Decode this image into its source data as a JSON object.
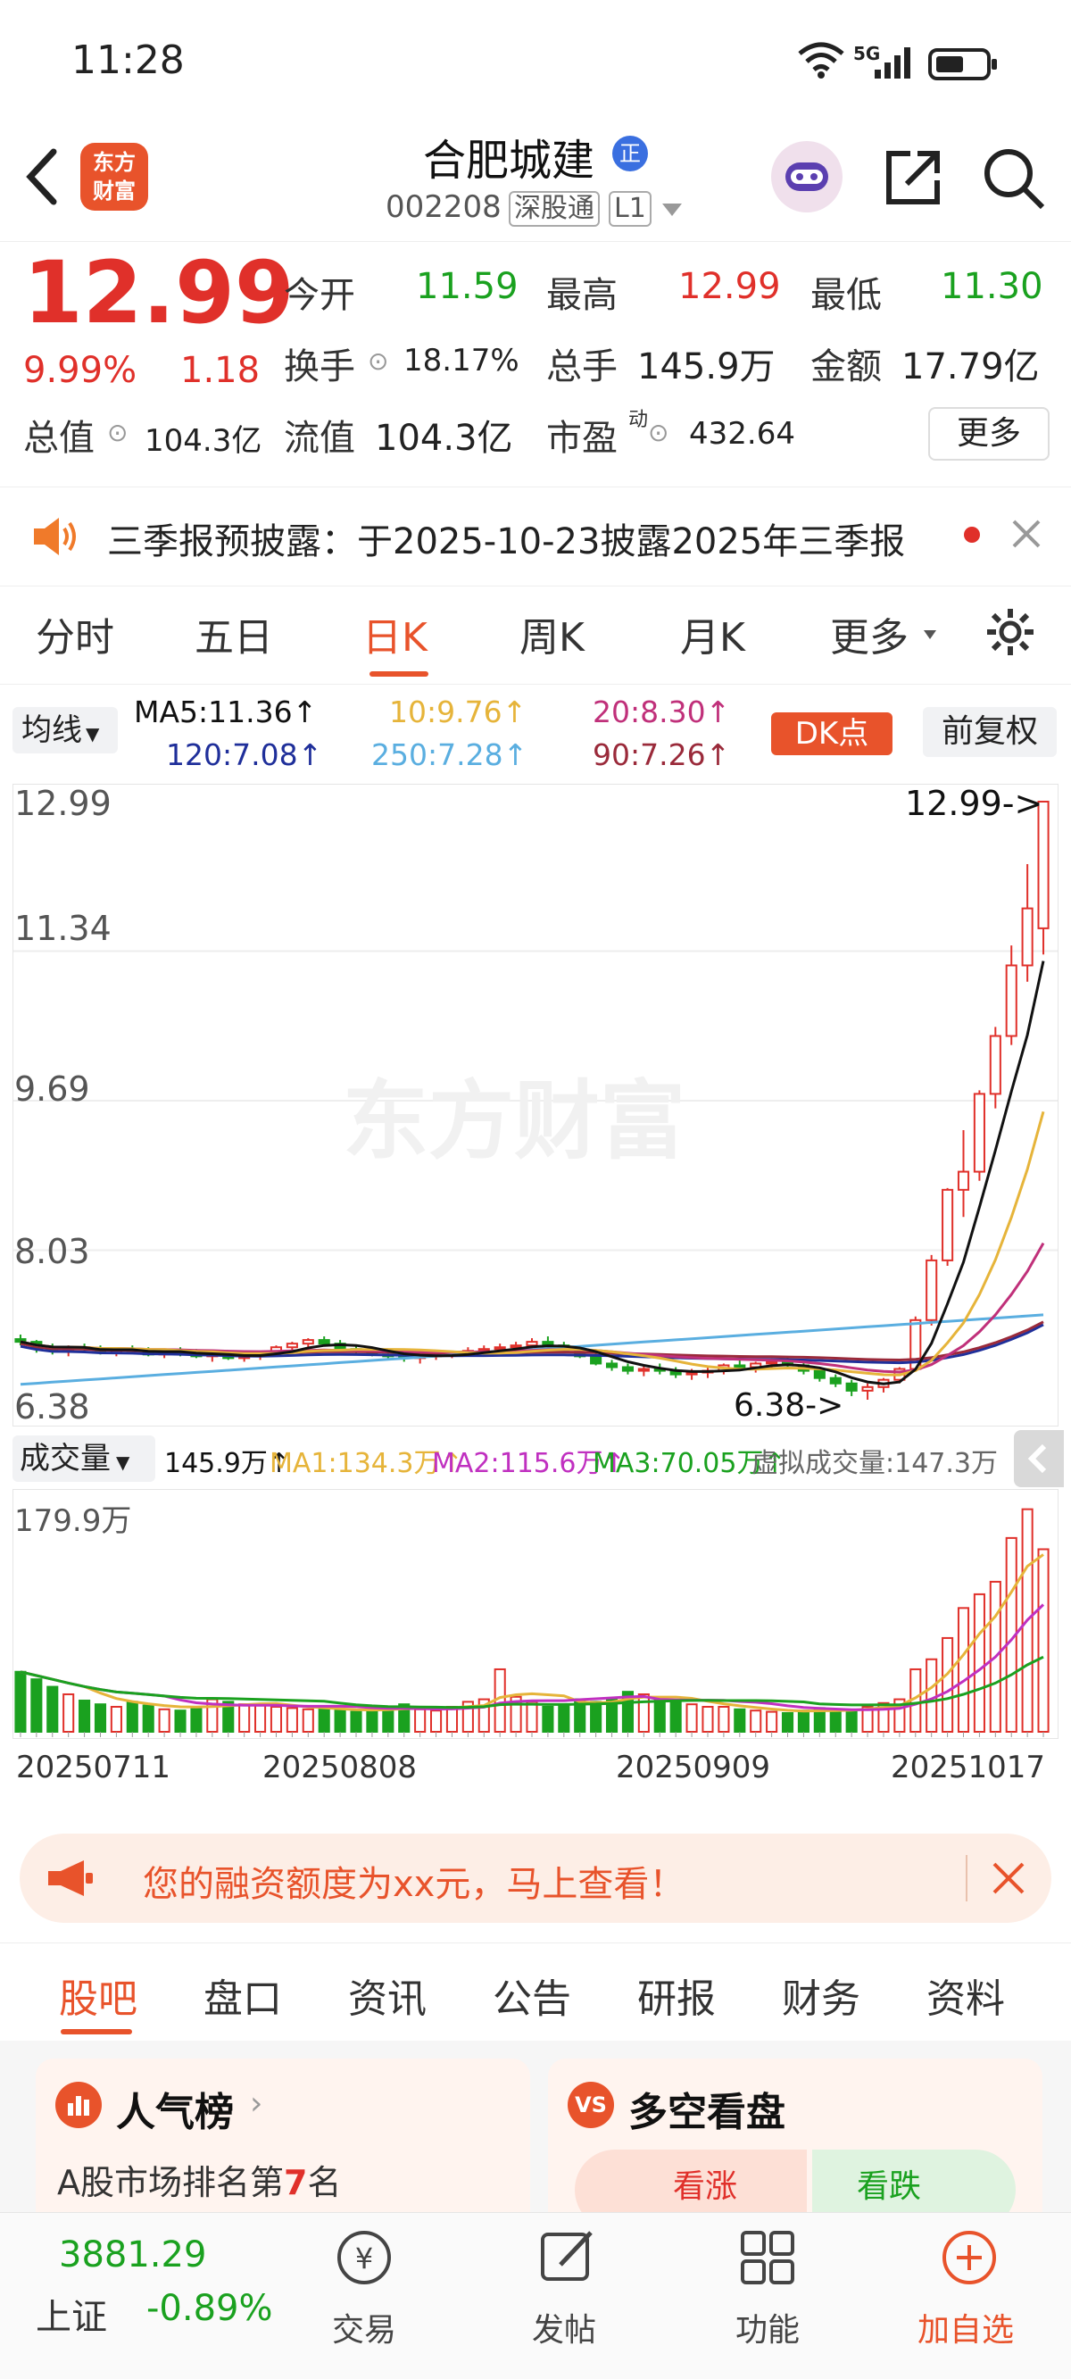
{
  "status_bar": {
    "time": "11:28",
    "signal": "5G"
  },
  "header": {
    "logo_text": "东方财富",
    "stock_name": "合肥城建",
    "badge": "正",
    "code": "002208",
    "exchange_tag": "深股通",
    "level_tag": "L1"
  },
  "quote": {
    "price": "12.99",
    "change_pct": "9.99%",
    "change_amt": "1.18",
    "open_label": "今开",
    "open": "11.59",
    "high_label": "最高",
    "high": "12.99",
    "low_label": "最低",
    "low": "11.30",
    "turnover_label": "换手",
    "turnover": "18.17%",
    "volume_label": "总手",
    "volume": "145.9万",
    "amount_label": "金额",
    "amount": "17.79亿",
    "mktcap_label": "总值",
    "mktcap": "104.3亿",
    "float_label": "流值",
    "float_cap": "104.3亿",
    "pe_label": "市盈",
    "pe_sup": "动",
    "pe": "432.64",
    "more_label": "更多"
  },
  "notice": {
    "text": "三季报预披露：于2025-10-23披露2025年三季报"
  },
  "chart_tabs": {
    "items": [
      "分时",
      "五日",
      "日K",
      "周K",
      "月K",
      "更多"
    ],
    "active": 2
  },
  "ma_row": {
    "selector": "均线",
    "ma5": "MA5:11.36↑",
    "ma10": "10:9.76↑",
    "ma20": "20:8.30↑",
    "ma120": "120:7.08↑",
    "ma250": "250:7.28↑",
    "ma90": "90:7.26↑",
    "dk_button": "DK点",
    "adjust_button": "前复权"
  },
  "colors": {
    "up": "#e0302a",
    "down": "#1aa11f",
    "ma5": "#111111",
    "ma10": "#e6b43a",
    "ma20": "#c0307a",
    "ma120": "#1f2f9a",
    "ma250": "#5aaee0",
    "ma90": "#9a2a3a",
    "accent": "#e8532b"
  },
  "kline": {
    "y_labels": [
      "12.99",
      "11.34",
      "9.69",
      "8.03",
      "6.38"
    ],
    "high_annotation": "12.99->",
    "low_annotation": "6.38->",
    "watermark": "东方财富",
    "signal_marks": [
      "K",
      "1",
      "2",
      "3",
      "4",
      "5",
      "6",
      "7",
      "8",
      "9",
      "K",
      "D",
      "K",
      "D",
      "B",
      "S",
      "3",
      "4",
      "5",
      "6",
      "7",
      "8",
      "9",
      "12"
    ]
  },
  "volume": {
    "selector": "成交量",
    "value": "145.9万↑",
    "ma1": "MA1:134.3万↑",
    "ma2": "MA2:115.6万↑",
    "ma3": "MA3:70.05万↑",
    "virtual": "虚拟成交量:147.3万",
    "max_label": "179.9万",
    "dates": [
      "20250711",
      "20250808",
      "20250909",
      "20251017"
    ]
  },
  "chart_data": {
    "type": "candlestick",
    "ylim": [
      6.38,
      12.99
    ],
    "approximate": true,
    "ohlc": [
      [
        7.05,
        7.1,
        6.98,
        7.02
      ],
      [
        7.02,
        7.04,
        6.9,
        6.95
      ],
      [
        6.95,
        7.0,
        6.88,
        6.92
      ],
      [
        6.92,
        6.98,
        6.86,
        6.96
      ],
      [
        6.96,
        7.0,
        6.9,
        6.94
      ],
      [
        6.94,
        6.98,
        6.88,
        6.9
      ],
      [
        6.9,
        6.96,
        6.86,
        6.94
      ],
      [
        6.94,
        6.98,
        6.9,
        6.92
      ],
      [
        6.92,
        6.96,
        6.86,
        6.88
      ],
      [
        6.88,
        6.94,
        6.84,
        6.92
      ],
      [
        6.92,
        6.96,
        6.86,
        6.9
      ],
      [
        6.9,
        6.94,
        6.84,
        6.86
      ],
      [
        6.86,
        6.9,
        6.8,
        6.88
      ],
      [
        6.88,
        6.92,
        6.82,
        6.84
      ],
      [
        6.84,
        6.9,
        6.8,
        6.86
      ],
      [
        6.86,
        6.92,
        6.82,
        6.9
      ],
      [
        6.9,
        6.98,
        6.86,
        6.96
      ],
      [
        6.96,
        7.02,
        6.92,
        7.0
      ],
      [
        7.0,
        7.06,
        6.96,
        7.04
      ],
      [
        7.04,
        7.08,
        6.98,
        7.0
      ],
      [
        7.0,
        7.04,
        6.92,
        6.94
      ],
      [
        6.94,
        6.98,
        6.88,
        6.92
      ],
      [
        6.92,
        6.96,
        6.86,
        6.88
      ],
      [
        6.88,
        6.92,
        6.82,
        6.86
      ],
      [
        6.86,
        6.9,
        6.8,
        6.84
      ],
      [
        6.84,
        6.88,
        6.78,
        6.86
      ],
      [
        6.86,
        6.9,
        6.82,
        6.88
      ],
      [
        6.88,
        6.92,
        6.84,
        6.9
      ],
      [
        6.9,
        6.96,
        6.86,
        6.92
      ],
      [
        6.92,
        6.98,
        6.88,
        6.94
      ],
      [
        6.94,
        7.0,
        6.9,
        6.96
      ],
      [
        6.96,
        7.02,
        6.92,
        6.98
      ],
      [
        6.98,
        7.06,
        6.94,
        7.02
      ],
      [
        7.02,
        7.08,
        6.96,
        6.98
      ],
      [
        6.98,
        7.02,
        6.9,
        6.92
      ],
      [
        6.92,
        6.96,
        6.84,
        6.86
      ],
      [
        6.86,
        6.9,
        6.76,
        6.78
      ],
      [
        6.78,
        6.82,
        6.7,
        6.74
      ],
      [
        6.74,
        6.78,
        6.66,
        6.7
      ],
      [
        6.7,
        6.76,
        6.64,
        6.72
      ],
      [
        6.72,
        6.78,
        6.66,
        6.7
      ],
      [
        6.7,
        6.74,
        6.62,
        6.66
      ],
      [
        6.66,
        6.72,
        6.6,
        6.68
      ],
      [
        6.68,
        6.74,
        6.62,
        6.7
      ],
      [
        6.7,
        6.78,
        6.66,
        6.76
      ],
      [
        6.76,
        6.82,
        6.7,
        6.74
      ],
      [
        6.74,
        6.8,
        6.68,
        6.78
      ],
      [
        6.78,
        6.84,
        6.72,
        6.8
      ],
      [
        6.8,
        6.86,
        6.74,
        6.76
      ],
      [
        6.76,
        6.8,
        6.66,
        6.7
      ],
      [
        6.7,
        6.74,
        6.58,
        6.62
      ],
      [
        6.62,
        6.66,
        6.52,
        6.56
      ],
      [
        6.56,
        6.6,
        6.42,
        6.48
      ],
      [
        6.48,
        6.56,
        6.38,
        6.52
      ],
      [
        6.52,
        6.62,
        6.46,
        6.6
      ],
      [
        6.6,
        6.74,
        6.56,
        6.72
      ],
      [
        6.72,
        7.3,
        6.7,
        7.26
      ],
      [
        7.26,
        7.98,
        7.2,
        7.92
      ],
      [
        7.92,
        8.72,
        7.86,
        8.7
      ],
      [
        8.7,
        9.36,
        8.4,
        8.9
      ],
      [
        8.9,
        9.8,
        8.8,
        9.76
      ],
      [
        9.76,
        10.5,
        9.6,
        10.4
      ],
      [
        10.4,
        11.4,
        10.3,
        11.18
      ],
      [
        11.18,
        12.3,
        11.0,
        11.81
      ],
      [
        11.59,
        12.99,
        11.3,
        12.99
      ]
    ],
    "volume_wan": [
      48,
      42,
      36,
      30,
      25,
      22,
      20,
      24,
      21,
      18,
      17,
      19,
      26,
      24,
      22,
      21,
      20,
      19,
      18,
      18,
      17,
      16,
      18,
      19,
      22,
      18,
      17,
      20,
      24,
      26,
      50,
      28,
      24,
      20,
      22,
      26,
      24,
      27,
      32,
      30,
      26,
      24,
      22,
      20,
      20,
      18,
      17,
      16,
      15,
      17,
      19,
      18,
      17,
      20,
      23,
      26,
      50,
      58,
      75,
      99,
      110,
      120,
      155,
      178,
      146
    ]
  },
  "promo": {
    "text": "您的融资额度为xx元，马上查看！"
  },
  "content_tabs": {
    "items": [
      "股吧",
      "盘口",
      "资讯",
      "公告",
      "研报",
      "财务",
      "资料"
    ],
    "active": 0
  },
  "cards": {
    "left_title": "人气榜",
    "left_sub_prefix": "A股市场排名第",
    "left_rank": "7",
    "left_sub_suffix": "名",
    "right_title": "多空看盘",
    "bull": "看涨",
    "bear": "看跌"
  },
  "bottom_nav": {
    "index_value": "3881.29",
    "index_name": "上证",
    "index_change": "-0.89%",
    "items": [
      "交易",
      "发帖",
      "功能",
      "加自选"
    ]
  }
}
